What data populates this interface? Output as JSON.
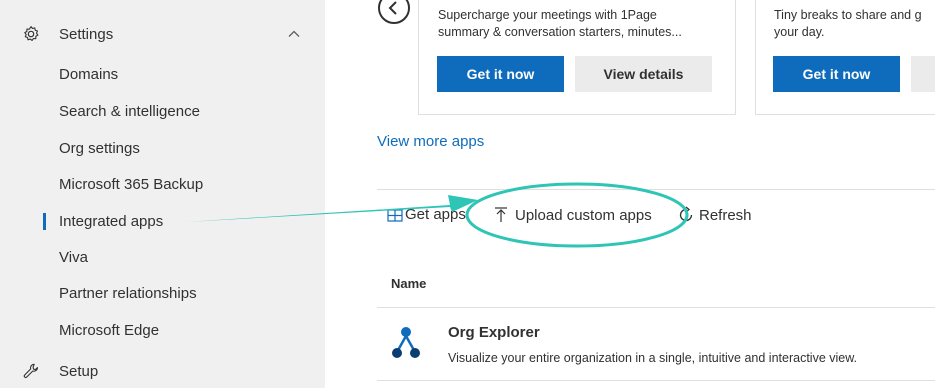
{
  "sidebar": {
    "settings_label": "Settings",
    "items": [
      {
        "label": "Domains"
      },
      {
        "label": "Search & intelligence"
      },
      {
        "label": "Org settings"
      },
      {
        "label": "Microsoft 365 Backup"
      },
      {
        "label": "Integrated apps"
      },
      {
        "label": "Viva"
      },
      {
        "label": "Partner relationships"
      },
      {
        "label": "Microsoft Edge"
      }
    ],
    "setup_label": "Setup",
    "active_item": "Integrated apps"
  },
  "cards": [
    {
      "description_line1": "Supercharge your meetings with 1Page",
      "description_line2": "summary & conversation starters, minutes...",
      "primary_label": "Get it now",
      "secondary_label": "View details"
    },
    {
      "description_line1": "Tiny breaks to share and g",
      "description_line2": "your day.",
      "primary_label": "Get it now"
    }
  ],
  "view_more_label": "View more apps",
  "commands": {
    "get_apps": "Get apps",
    "upload_custom_apps": "Upload custom apps",
    "refresh": "Refresh"
  },
  "table": {
    "column_name": "Name",
    "rows": [
      {
        "name": "Org Explorer",
        "description": "Visualize your entire organization in a single, intuitive and interactive view.",
        "icon": "org-chart-icon"
      }
    ]
  },
  "colors": {
    "accent": "#0f6cbd",
    "annotation": "#2ec4b6",
    "sidebar_bg": "#f0f0f0"
  }
}
